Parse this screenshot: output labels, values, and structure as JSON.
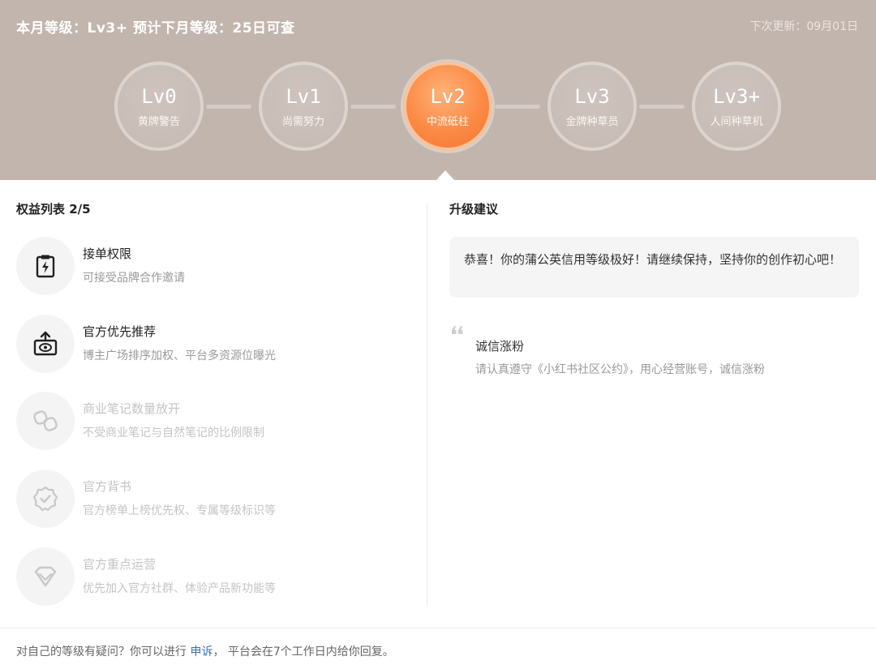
{
  "header": {
    "title": "本月等级：Lv3+  预计下月等级：25日可查",
    "next_update": "下次更新：09月01日"
  },
  "levels": [
    {
      "name": "Lv0",
      "sub": "黄牌警告"
    },
    {
      "name": "Lv1",
      "sub": "尚需努力"
    },
    {
      "name": "Lv2",
      "sub": "中流砥柱",
      "active": true
    },
    {
      "name": "Lv3",
      "sub": "金牌种草员"
    },
    {
      "name": "Lv3+",
      "sub": "人间种草机"
    }
  ],
  "benefits": {
    "title": "权益列表 2/5",
    "items": [
      {
        "title": "接单权限",
        "desc": "可接受品牌合作邀请",
        "icon": "order-permission-icon",
        "enabled": true
      },
      {
        "title": "官方优先推荐",
        "desc": "博主广场排序加权、平台多资源位曝光",
        "icon": "recommend-eye-icon",
        "enabled": true
      },
      {
        "title": "商业笔记数量放开",
        "desc": "不受商业笔记与自然笔记的比例限制",
        "icon": "link-chain-icon",
        "enabled": false
      },
      {
        "title": "官方背书",
        "desc": "官方榜单上榜优先权、专属等级标识等",
        "icon": "badge-check-icon",
        "enabled": false
      },
      {
        "title": "官方重点运营",
        "desc": "优先加入官方社群、体验产品新功能等",
        "icon": "diamond-icon",
        "enabled": false
      }
    ]
  },
  "suggestion": {
    "title": "升级建议",
    "message": "恭喜！你的蒲公英信用等级极好！请继续保持，坚持你的创作初心吧！",
    "tip_title": "诚信涨粉",
    "tip_desc": "请认真遵守《小红书社区公约》，用心经营账号，诚信涨粉"
  },
  "footer": {
    "prefix": "对自己的等级有疑问？你可以进行",
    "link": "申诉",
    "suffix": "， 平台会在7个工作日内给你回复。"
  },
  "colors": {
    "header_bg": "#c2b5ae",
    "active_level": "#fb8a45",
    "link": "#3a6fb7"
  }
}
